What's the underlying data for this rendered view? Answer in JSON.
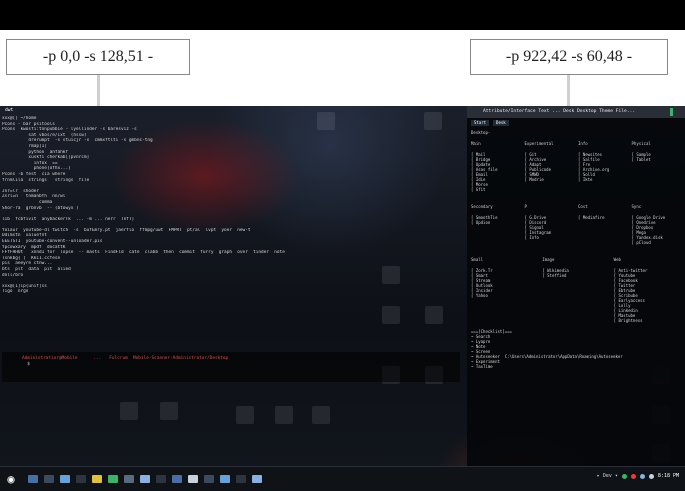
{
  "callouts": [
    {
      "label": "-p 0,0 -s 128,51 -"
    },
    {
      "label": "-p 922,42 -s 60,48 -"
    }
  ],
  "left_terminal": {
    "title": "dwt",
    "lines": [
      "xxx@[] ~/home",
      "Pcons - bar psitools",
      "Pcons  kwosfi:tnnpubbie - lyellinder -s baresviz -s",
      "          sat vbos/e/ixt  (hssw)",
      "          drerumpt  -s stuicjr -x  cmmxftlti -s gmbnc-tng",
      "          rmap[1]",
      "          python  anfahkf",
      "          xuskfi cherkab[[pvnrcm]",
      "            infox  ==",
      "            phone[ofhx...]",
      "Pcons -b fest  cia where",
      "frnmlila  strings   strings  file",
      "",
      "Jnr=lr  shoder",
      "Zsrl=n   tnmanbfh  nn/wl",
      "              comma",
      "Shor-ra  grbnvb  -- (btowyx )",
      "",
      "lib  fcbfivit  anybackerTk  ... -m ... nerr  TnfT]",
      "",
      "Yoiaur  youtube-dl twitch  -s  bufEmry.pt  jaerflo  ffmpg/uwt  FMPRT  pt/al  lvpt  yoer  new-t",
      "Ddimstn  xaluefnt",
      "EEETSTI  youtube-convent--unloader.pis",
      "Ypcowxary  mpdf  docattK",
      "FFfFHHUt   xnnd1 for  lopse  -- masts  FindFld  cate  clabb  then  commit  furry  graph  over  tinder  note",
      "Tsnkbg{ ]  Kki1.ccfese",
      "pis  aeeyre ctnw...",
      "bts  plt  data  pit  alied",
      "dnll/bro",
      "",
      "xxx@[1]ip{unif]ss",
      "Tigo  nrgn"
    ]
  },
  "bottom_terminal": {
    "lines": [
      "Administratior@Mobile      ...   Fulcrum  Mobile-Scanner-Administrator/Desktop",
      "  $"
    ]
  },
  "right_panel": {
    "title": "Attribute/Interface  Text  ...  Desk  Desktop  Theme  File...",
    "tabs": [
      "Start",
      "Desk"
    ],
    "header": "Desktop-",
    "sections": [
      {
        "columns": [
          "Main",
          "Experimental",
          "Info",
          "Physical"
        ],
        "rows": [
          [
            "[ Mail",
            "[ Git",
            "[ Newsites",
            "[ Sample"
          ],
          [
            "[ Bridge",
            "[ Archive",
            "[ Salfile",
            "[ Tablet"
          ],
          [
            "[ Update",
            "[ Adapt",
            "[ Fre",
            ""
          ],
          [
            "[ Asos file",
            "[ Publicode",
            "[ Archive.org",
            ""
          ],
          [
            "[ Email",
            "[ SMWD",
            "[ Solld",
            ""
          ],
          [
            "[ Idie",
            "[ Modrie",
            "[ Ikte",
            ""
          ],
          [
            "[ Morse",
            "",
            "",
            ""
          ],
          [
            "[ Gfit",
            "",
            "",
            ""
          ]
        ]
      },
      {
        "columns": [
          "Secondary",
          "P",
          "Cost",
          "Sync"
        ],
        "rows": [
          [
            "[ SmoothTie",
            "[ G.Drive",
            "[ Mediafire",
            "[ Google Drive"
          ],
          [
            "[ Updion",
            "[ Discord",
            "",
            "[ Onedrive"
          ],
          [
            "",
            "[ Signal",
            "",
            "[ Dropbox"
          ],
          [
            "",
            "[ Instagram",
            "",
            "[ Mega"
          ],
          [
            "",
            "[ Info",
            "",
            "[ Yandex.disk"
          ],
          [
            "",
            "",
            "",
            "[ pCloud"
          ]
        ]
      },
      {
        "columns": [
          "Small",
          "Image",
          "Web"
        ],
        "rows": [
          [
            "[ Zork.Tr",
            "[ Wikimedia",
            "[ Anti-twitter"
          ],
          [
            "[ Smart",
            "[ Steffied",
            "[ Youtube"
          ],
          [
            "[ Stream",
            "",
            "[ Facebook"
          ],
          [
            "[ Outlook",
            "",
            "[ Twitter"
          ],
          [
            "[ Insider",
            "",
            "[ Ebtrube"
          ],
          [
            "[ Yahoo",
            "",
            "[ Scribube"
          ],
          [
            "",
            "",
            "[ Earlyaccess"
          ],
          [
            "",
            "",
            "[ Lolly"
          ],
          [
            "",
            "",
            "[ Linkedin"
          ],
          [
            "",
            "",
            "[ Mastube"
          ],
          [
            "",
            "",
            "[ Brightness"
          ]
        ]
      }
    ],
    "footer_lines": [
      "===[Checklist]===",
      "~ Search",
      "~ Lyapre",
      "~ Note",
      "~ Screen",
      "~ Autoseeker  C:\\Users\\Administrator\\AppData\\Roaming\\Autoseeker",
      "~ Experiment",
      "~ TaxTime"
    ]
  },
  "taskbar": {
    "start_glyph": "◉",
    "tray_text": "▸  Dev ▾",
    "clock": "8:18 PM"
  },
  "colors": {
    "taskbar_green": "#3db36a",
    "tray_red": "#e04040",
    "window_accent": "#3db36a"
  }
}
